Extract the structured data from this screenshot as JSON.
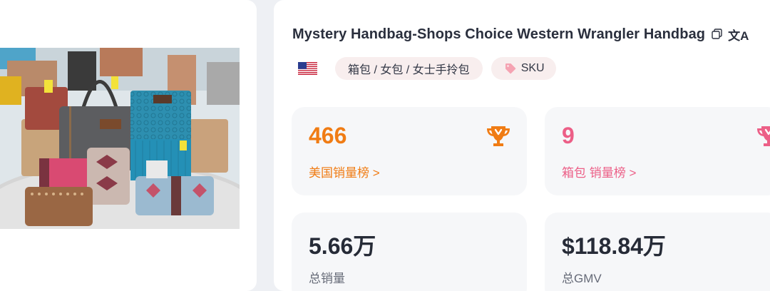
{
  "product": {
    "title": "Mystery Handbag-Shops Choice Western Wrangler Handbag",
    "translate_glyph": "文A"
  },
  "tags": {
    "country_flag": "us-flag-icon",
    "category": "箱包 / 女包 / 女士手拎包",
    "sku_label": "SKU"
  },
  "stats": {
    "us_rank": {
      "value": "466",
      "label": "美国销量榜 >",
      "color": "#f07c14"
    },
    "category_rank": {
      "value": "9",
      "label": "箱包 销量榜 >",
      "color": "#ec5f87"
    },
    "total_sales": {
      "value": "5.66万",
      "label": "总销量"
    },
    "total_gmv": {
      "value": "$118.84万",
      "label": "总GMV"
    }
  }
}
